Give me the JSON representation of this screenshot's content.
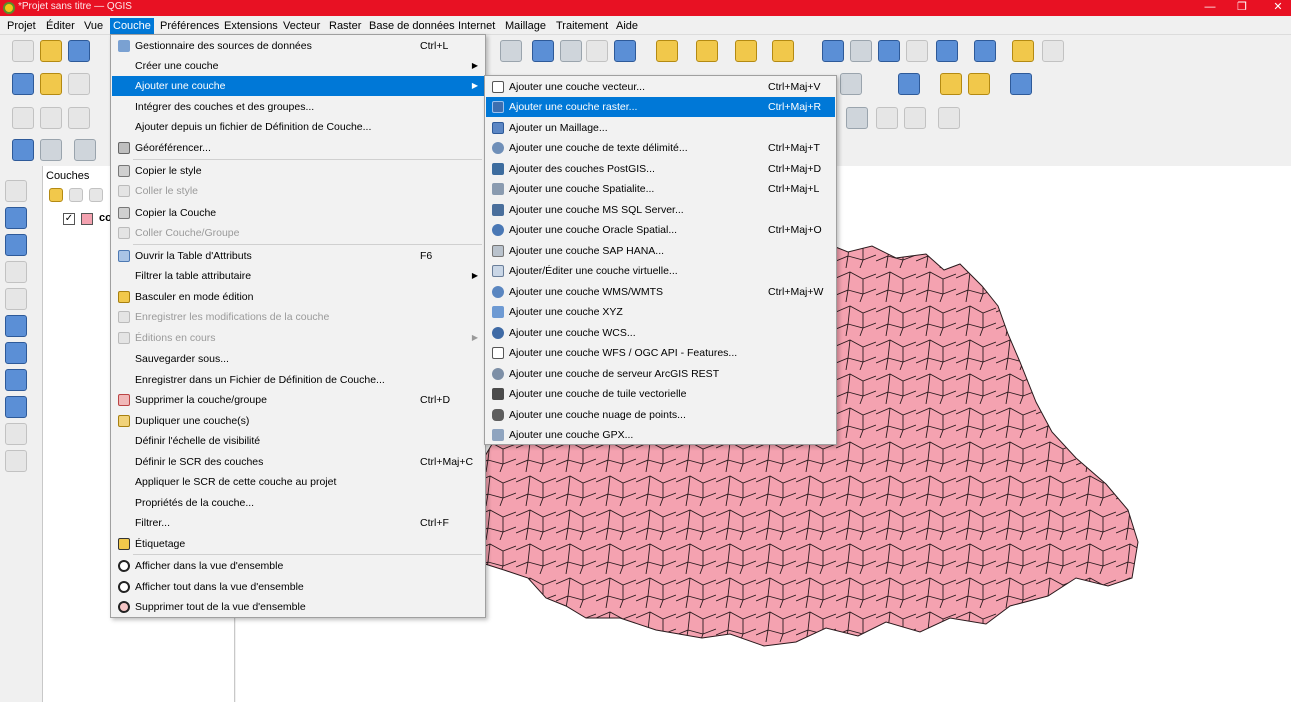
{
  "window": {
    "title": "*Projet sans titre — QGIS",
    "minimize_glyph": "—",
    "restore_glyph": "❐",
    "close_glyph": "✕"
  },
  "menubar": [
    {
      "label": "Projet",
      "active": false
    },
    {
      "label": "Éditer",
      "active": false
    },
    {
      "label": "Vue",
      "active": false
    },
    {
      "label": "Couche",
      "active": true
    },
    {
      "label": "Préférences",
      "active": false
    },
    {
      "label": "Extensions",
      "active": false
    },
    {
      "label": "Vecteur",
      "active": false
    },
    {
      "label": "Raster",
      "active": false
    },
    {
      "label": "Base de données",
      "active": false
    },
    {
      "label": "Internet",
      "active": false
    },
    {
      "label": "Maillage",
      "active": false
    },
    {
      "label": "Traitement",
      "active": false
    },
    {
      "label": "Aide",
      "active": false
    }
  ],
  "layers_panel": {
    "title": "Couches",
    "layer": {
      "name": "co",
      "checked": true,
      "check_glyph": "✓",
      "color": "#f4a2b0"
    }
  },
  "couche_menu": {
    "items": [
      {
        "label": "Gestionnaire des sources de données",
        "shortcut": "Ctrl+L",
        "icon": "data-source-manager-icon",
        "state": "normal"
      },
      {
        "label": "Créer une couche",
        "shortcut": "",
        "icon": "",
        "state": "normal",
        "submenu": true
      },
      {
        "label": "Ajouter une couche",
        "shortcut": "",
        "icon": "",
        "state": "highlighted",
        "submenu": true
      },
      {
        "label": "Intégrer des couches et des groupes...",
        "shortcut": "",
        "icon": "",
        "state": "normal"
      },
      {
        "label": "Ajouter depuis un fichier de Définition de Couche...",
        "shortcut": "",
        "icon": "",
        "state": "normal"
      },
      {
        "label": "Géoréférencer...",
        "shortcut": "",
        "icon": "georeferencer-icon",
        "state": "normal"
      },
      {
        "label": "Copier le style",
        "shortcut": "",
        "icon": "copy-style-icon",
        "state": "normal"
      },
      {
        "label": "Coller le style",
        "shortcut": "",
        "icon": "paste-style-icon",
        "state": "disabled"
      },
      {
        "label": "Copier la Couche",
        "shortcut": "",
        "icon": "copy-layer-icon",
        "state": "normal"
      },
      {
        "label": "Coller Couche/Groupe",
        "shortcut": "",
        "icon": "paste-layer-icon",
        "state": "disabled"
      },
      {
        "label": "Ouvrir la Table d'Attributs",
        "shortcut": "F6",
        "icon": "attribute-table-icon",
        "state": "normal"
      },
      {
        "label": "Filtrer la table attributaire",
        "shortcut": "",
        "icon": "",
        "state": "normal",
        "submenu": true
      },
      {
        "label": "Basculer en mode édition",
        "shortcut": "",
        "icon": "pencil-icon",
        "state": "normal"
      },
      {
        "label": "Enregistrer les modifications de la couche",
        "shortcut": "",
        "icon": "save-edits-icon",
        "state": "disabled"
      },
      {
        "label": "Éditions en cours",
        "shortcut": "",
        "icon": "current-edits-icon",
        "state": "disabled",
        "submenu": true
      },
      {
        "label": "Sauvegarder sous...",
        "shortcut": "",
        "icon": "",
        "state": "normal"
      },
      {
        "label": "Enregistrer dans un Fichier de Définition de Couche...",
        "shortcut": "",
        "icon": "",
        "state": "normal"
      },
      {
        "label": "Supprimer la couche/groupe",
        "shortcut": "Ctrl+D",
        "icon": "remove-layer-icon",
        "state": "normal"
      },
      {
        "label": "Dupliquer une couche(s)",
        "shortcut": "",
        "icon": "duplicate-layer-icon",
        "state": "normal"
      },
      {
        "label": "Définir l'échelle de visibilité",
        "shortcut": "",
        "icon": "",
        "state": "normal"
      },
      {
        "label": "Définir le SCR des couches",
        "shortcut": "Ctrl+Maj+C",
        "icon": "",
        "state": "normal"
      },
      {
        "label": "Appliquer le SCR de cette couche au projet",
        "shortcut": "",
        "icon": "",
        "state": "normal"
      },
      {
        "label": "Propriétés de la couche...",
        "shortcut": "",
        "icon": "",
        "state": "normal"
      },
      {
        "label": "Filtrer...",
        "shortcut": "Ctrl+F",
        "icon": "",
        "state": "normal"
      },
      {
        "label": "Étiquetage",
        "shortcut": "",
        "icon": "labeling-icon",
        "state": "normal"
      },
      {
        "label": "Afficher dans la vue d'ensemble",
        "shortcut": "",
        "icon": "overview-show-icon",
        "state": "normal"
      },
      {
        "label": "Afficher tout dans la vue d'ensemble",
        "shortcut": "",
        "icon": "overview-show-all-icon",
        "state": "normal"
      },
      {
        "label": "Supprimer tout de la vue d'ensemble",
        "shortcut": "",
        "icon": "overview-remove-icon",
        "state": "normal"
      }
    ]
  },
  "ajouter_submenu": {
    "items": [
      {
        "label": "Ajouter une couche vecteur...",
        "shortcut": "Ctrl+Maj+V",
        "icon": "vector-layer-icon",
        "state": "normal"
      },
      {
        "label": "Ajouter une couche raster...",
        "shortcut": "Ctrl+Maj+R",
        "icon": "raster-layer-icon",
        "state": "highlighted"
      },
      {
        "label": "Ajouter un Maillage...",
        "shortcut": "",
        "icon": "mesh-layer-icon",
        "state": "normal"
      },
      {
        "label": "Ajouter une couche de texte délimité...",
        "shortcut": "Ctrl+Maj+T",
        "icon": "delimited-text-icon",
        "state": "normal"
      },
      {
        "label": "Ajouter des couches PostGIS...",
        "shortcut": "Ctrl+Maj+D",
        "icon": "postgis-icon",
        "state": "normal"
      },
      {
        "label": "Ajouter une couche Spatialite...",
        "shortcut": "Ctrl+Maj+L",
        "icon": "spatialite-icon",
        "state": "normal"
      },
      {
        "label": "Ajouter une couche MS SQL Server...",
        "shortcut": "",
        "icon": "mssql-icon",
        "state": "normal"
      },
      {
        "label": "Ajouter une couche Oracle Spatial...",
        "shortcut": "Ctrl+Maj+O",
        "icon": "oracle-icon",
        "state": "normal"
      },
      {
        "label": "Ajouter une couche SAP HANA...",
        "shortcut": "",
        "icon": "sap-hana-icon",
        "state": "normal"
      },
      {
        "label": "Ajouter/Éditer une couche virtuelle...",
        "shortcut": "",
        "icon": "virtual-layer-icon",
        "state": "normal"
      },
      {
        "label": "Ajouter une couche WMS/WMTS",
        "shortcut": "Ctrl+Maj+W",
        "icon": "wms-icon",
        "state": "normal"
      },
      {
        "label": "Ajouter une couche XYZ",
        "shortcut": "",
        "icon": "xyz-icon",
        "state": "normal"
      },
      {
        "label": "Ajouter une couche WCS...",
        "shortcut": "",
        "icon": "wcs-icon",
        "state": "normal"
      },
      {
        "label": "Ajouter une couche WFS / OGC API - Features...",
        "shortcut": "",
        "icon": "wfs-icon",
        "state": "normal"
      },
      {
        "label": "Ajouter une couche de serveur ArcGIS REST",
        "shortcut": "",
        "icon": "arcgis-rest-icon",
        "state": "normal"
      },
      {
        "label": "Ajouter une couche de tuile vectorielle",
        "shortcut": "",
        "icon": "vector-tile-icon",
        "state": "normal"
      },
      {
        "label": "Ajouter une couche nuage de points...",
        "shortcut": "",
        "icon": "point-cloud-icon",
        "state": "normal"
      },
      {
        "label": "Ajouter une couche GPX...",
        "shortcut": "",
        "icon": "gpx-icon",
        "state": "normal"
      }
    ]
  },
  "map": {
    "fill_color": "#f4a2b0",
    "stroke_color": "#2a1a1d"
  },
  "colors": {
    "titlebar": "#e81123",
    "menu_highlight": "#0078d7",
    "disabled_text": "#9a9a9a"
  }
}
